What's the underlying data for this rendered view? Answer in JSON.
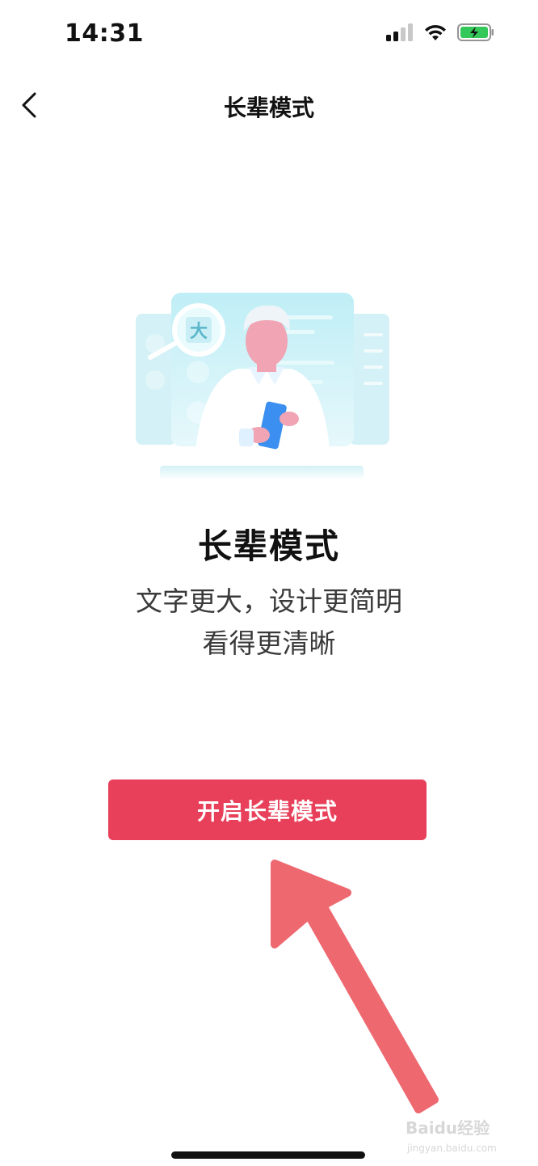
{
  "status_bar": {
    "time": "14:31",
    "icons": [
      "cellular-signal-icon",
      "wifi-icon",
      "battery-charging-icon"
    ]
  },
  "nav": {
    "back_icon": "chevron-left-icon",
    "title": "长辈模式"
  },
  "illustration": {
    "magnifier_text": "大",
    "colors": {
      "panel": "#b9eaf2",
      "panel_light": "#dff6fa",
      "figure_skin": "#f0a4b4",
      "phone": "#3a8ff0"
    }
  },
  "content": {
    "headline": "长辈模式",
    "description_lines": [
      "文字更大，设计更简明",
      "看得更清晰"
    ]
  },
  "cta": {
    "label": "开启长辈模式",
    "color": "#e8405a"
  },
  "watermark": {
    "brand": "Baidu经验",
    "url": "jingyan.baidu.com"
  }
}
